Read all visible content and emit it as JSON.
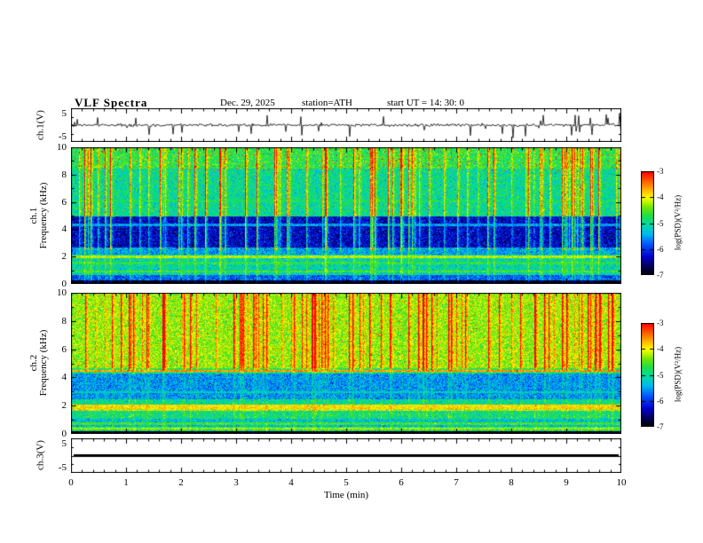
{
  "header": {
    "title": "VLF  Spectra",
    "date": "Dec. 29,  2025",
    "station": "station=ATH",
    "start_ut": "start  UT  =   14: 30: 0"
  },
  "xaxis": {
    "label": "Time  (min)",
    "range": [
      0,
      10
    ],
    "ticks": [
      0,
      1,
      2,
      3,
      4,
      5,
      6,
      7,
      8,
      9,
      10
    ]
  },
  "colorbar": {
    "label": "log(PSD)(V²/Hz)",
    "range": [
      -7,
      -3
    ],
    "ticks": [
      -3,
      -4,
      -5,
      -6,
      -7
    ]
  },
  "colors": {
    "background": "#ffffff",
    "axis": "#000000",
    "trace": "#000000",
    "colormap": [
      [
        0.0,
        "#000000"
      ],
      [
        0.08,
        "#00004d"
      ],
      [
        0.18,
        "#0000cc"
      ],
      [
        0.3,
        "#0055ff"
      ],
      [
        0.4,
        "#00bbee"
      ],
      [
        0.5,
        "#00dd99"
      ],
      [
        0.58,
        "#22dd44"
      ],
      [
        0.66,
        "#77e800"
      ],
      [
        0.75,
        "#ffff00"
      ],
      [
        0.85,
        "#ff9900"
      ],
      [
        1.0,
        "#ff0000"
      ]
    ]
  },
  "chart_data": [
    {
      "type": "line",
      "id": "ch1_waveform",
      "ylabel": "ch.1(V)",
      "xlim": [
        0,
        10
      ],
      "ylim": [
        -5,
        5
      ],
      "ytick_labels": [
        "5",
        "-5"
      ],
      "signal": "continuous broadband noise ~±1 V with dense impulsive spikes up to ±4 V"
    },
    {
      "type": "heatmap",
      "id": "ch1_spectrogram",
      "ylabel_line1": "ch.1",
      "ylabel_line2": "Frequency (kHz)",
      "xlim": [
        0,
        10
      ],
      "ylim": [
        0,
        10
      ],
      "yticks": [
        0,
        2,
        4,
        6,
        8,
        10
      ],
      "zlabel": "log(PSD)(V²/Hz)",
      "zlim": [
        -7,
        -3
      ],
      "bands": [
        {
          "f": [
            0,
            0.3
          ],
          "psd": -7.0
        },
        {
          "f": [
            0.3,
            0.7
          ],
          "psd": -5.8
        },
        {
          "f": [
            0.7,
            2.2
          ],
          "psd": -5.1
        },
        {
          "f": [
            2.2,
            2.7
          ],
          "psd": -5.5
        },
        {
          "f": [
            2.7,
            5.0
          ],
          "psd": -6.3
        },
        {
          "f": [
            5.0,
            8.5
          ],
          "psd": -5.0
        },
        {
          "f": [
            8.5,
            10
          ],
          "psd": -4.7
        }
      ],
      "lines": [
        {
          "f": 0.95,
          "psd": -4.6
        },
        {
          "f": 1.55,
          "psd": -4.7
        },
        {
          "f": 2.0,
          "psd": -4.2
        },
        {
          "f": 4.35,
          "psd": -5.5
        },
        {
          "f": 6.1,
          "psd": -4.9
        }
      ],
      "transients": {
        "density": 0.12,
        "strength": 1.5,
        "fmin": 2.5,
        "sub": 0.35
      },
      "speckle": {
        "fmin": 8.3,
        "p": 0.025,
        "psd": -3.2
      }
    },
    {
      "type": "heatmap",
      "id": "ch2_spectrogram",
      "ylabel_line1": "ch.2",
      "ylabel_line2": "Frequency (kHz)",
      "xlim": [
        0,
        10
      ],
      "ylim": [
        0,
        10
      ],
      "yticks": [
        0,
        2,
        4,
        6,
        8,
        10
      ],
      "zlabel": "log(PSD)(V²/Hz)",
      "zlim": [
        -7,
        -3
      ],
      "bands": [
        {
          "f": [
            0,
            0.25
          ],
          "psd": -7.0
        },
        {
          "f": [
            0.25,
            0.55
          ],
          "psd": -4.8
        },
        {
          "f": [
            0.55,
            1.1
          ],
          "psd": -5.3
        },
        {
          "f": [
            1.1,
            1.65
          ],
          "psd": -4.9
        },
        {
          "f": [
            1.65,
            2.1
          ],
          "psd": -4.15
        },
        {
          "f": [
            2.1,
            2.5
          ],
          "psd": -5.0
        },
        {
          "f": [
            2.5,
            4.3
          ],
          "psd": -5.55
        },
        {
          "f": [
            4.3,
            4.7
          ],
          "psd": -4.8
        },
        {
          "f": [
            4.7,
            10
          ],
          "psd": -4.3
        }
      ],
      "lines": [
        {
          "f": 0.4,
          "psd": -4.3
        },
        {
          "f": 0.75,
          "psd": -4.6
        },
        {
          "f": 1.85,
          "psd": -3.9
        },
        {
          "f": 2.0,
          "psd": -4.0
        },
        {
          "f": 3.0,
          "psd": -5.2
        },
        {
          "f": 4.5,
          "psd": -3.6
        }
      ],
      "transients": {
        "density": 0.16,
        "strength": 1.4,
        "fmin": 4.5,
        "sub": 0.2
      },
      "speckle": {
        "fmin": 4.8,
        "p": 0.012,
        "psd": -3.2
      }
    },
    {
      "type": "line",
      "id": "ch3_waveform",
      "ylabel": "ch.3(V)",
      "xlim": [
        0,
        10
      ],
      "ylim": [
        -5,
        5
      ],
      "ytick_labels": [
        "5",
        "-5"
      ],
      "signal": "flat line at 0 V"
    }
  ]
}
